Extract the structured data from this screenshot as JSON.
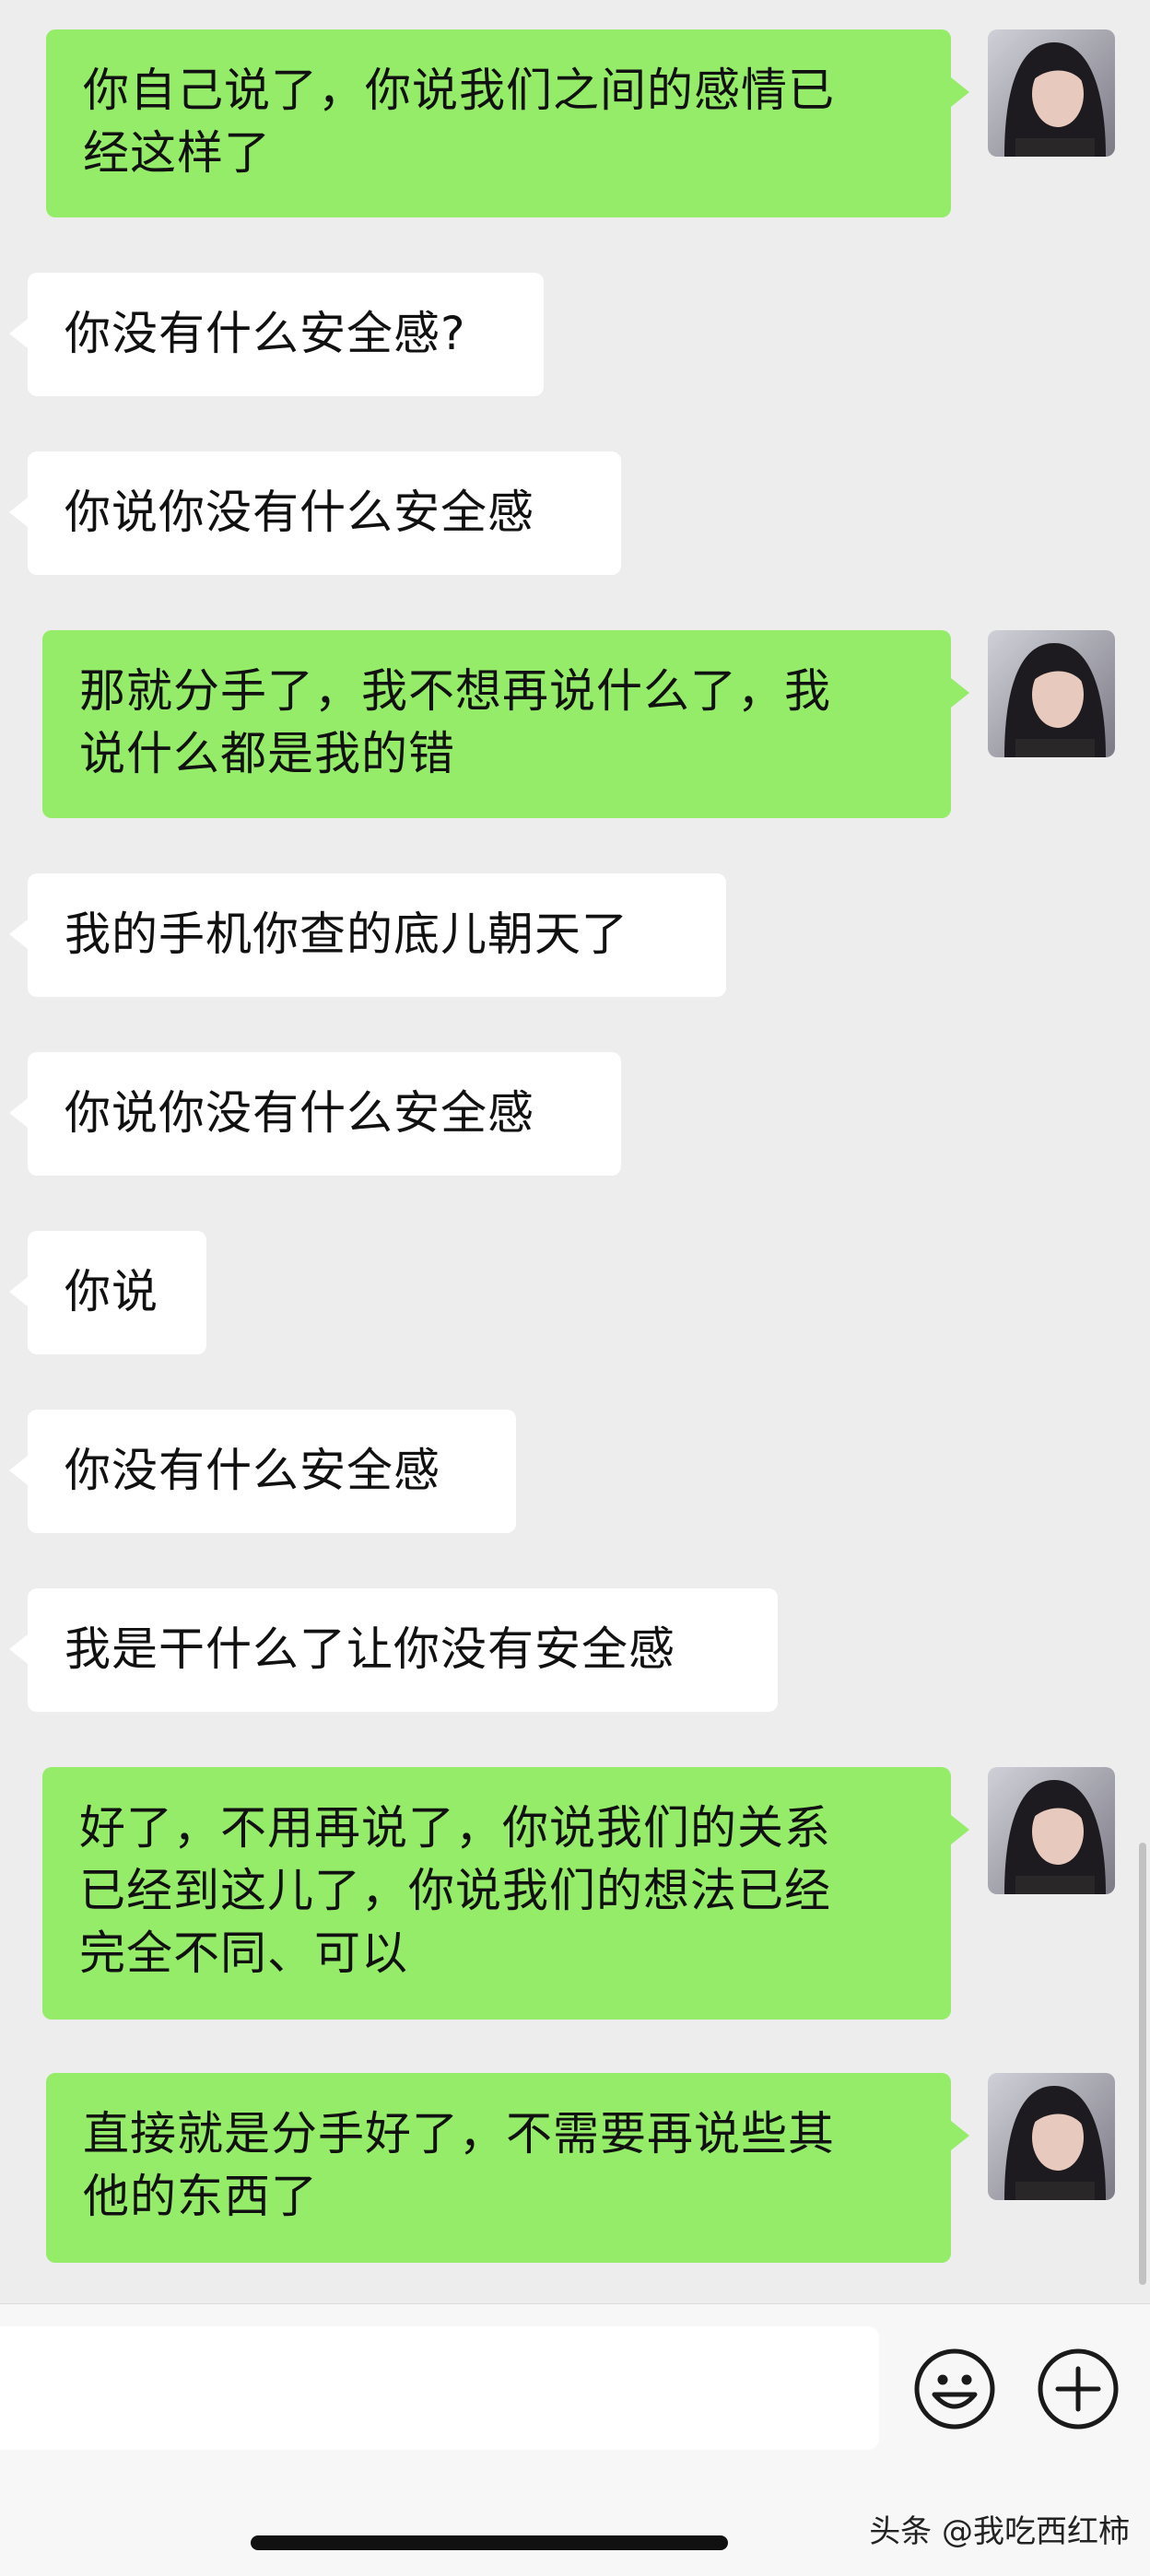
{
  "messages": [
    {
      "side": "sent",
      "text": "你自己说了，你说我们之间的感情已\n经这样了"
    },
    {
      "side": "recv",
      "text": "你没有什么安全感?"
    },
    {
      "side": "recv",
      "text": "你说你没有什么安全感"
    },
    {
      "side": "sent",
      "text": "那就分手了，我不想再说什么了，我\n说什么都是我的错"
    },
    {
      "side": "recv",
      "text": "我的手机你查的底儿朝天了"
    },
    {
      "side": "recv",
      "text": "你说你没有什么安全感"
    },
    {
      "side": "recv",
      "text": "你说"
    },
    {
      "side": "recv",
      "text": "你没有什么安全感"
    },
    {
      "side": "recv",
      "text": "我是干什么了让你没有安全感"
    },
    {
      "side": "sent",
      "text": "好了，不用再说了，你说我们的关系\n已经到这儿了，你说我们的想法已经\n完全不同、可以"
    },
    {
      "side": "sent",
      "text": "直接就是分手好了，不需要再说些其\n他的东西了"
    }
  ],
  "input_bar": {
    "emoji_icon": "emoji-face-icon",
    "plus_icon": "plus-circle-icon"
  },
  "watermark": "头条 @我吃西红柿",
  "colors": {
    "background": "#ededed",
    "sent_bubble": "#95ec69",
    "recv_bubble": "#ffffff"
  }
}
